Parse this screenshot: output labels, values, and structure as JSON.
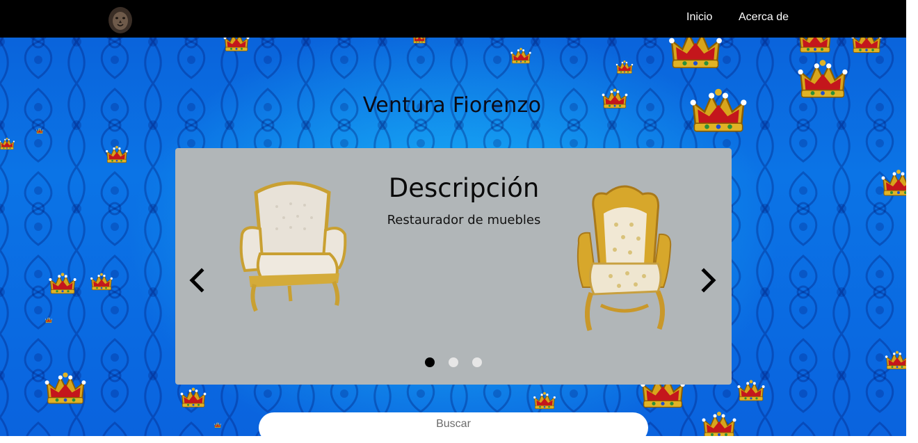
{
  "navbar": {
    "logo_icon": "lion-head-logo-icon",
    "links": [
      {
        "label": "Inicio"
      },
      {
        "label": "Acerca de"
      }
    ]
  },
  "main": {
    "title": "Ventura Fiorenzo"
  },
  "carousel": {
    "active_index": 0,
    "slide_count": 3,
    "slide": {
      "heading": "Descripción",
      "text": "Restaurador de muebles",
      "images": [
        "white-gold-armchair-image",
        "gold-ornate-throne-chair-image"
      ]
    },
    "prev_icon": "chevron-left-icon",
    "next_icon": "chevron-right-icon"
  },
  "search": {
    "placeholder": "Buscar"
  },
  "colors": {
    "navbar": "#000000",
    "background_blue": "#0b74e6",
    "carousel_panel": "#b1b6b8",
    "dot_active": "#000000",
    "dot_inactive": "#e6e6e6"
  }
}
